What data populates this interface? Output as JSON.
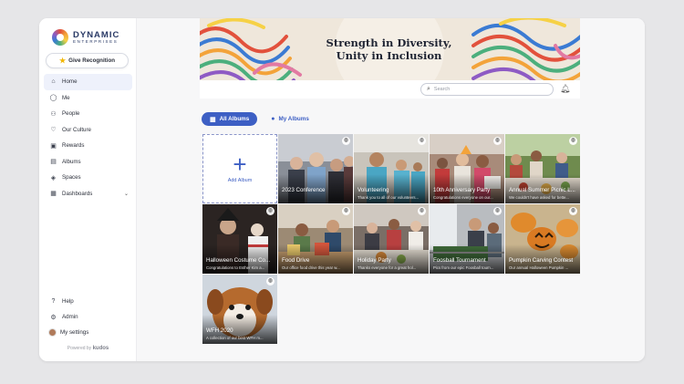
{
  "brand": {
    "name": "DYNAMIC",
    "sub": "ENTERPRISES"
  },
  "give_recognition": "Give Recognition",
  "nav": [
    {
      "label": "Home",
      "icon": "home-icon"
    },
    {
      "label": "Me",
      "icon": "user-icon"
    },
    {
      "label": "People",
      "icon": "people-icon"
    },
    {
      "label": "Our Culture",
      "icon": "heart-icon"
    },
    {
      "label": "Rewards",
      "icon": "gift-icon"
    },
    {
      "label": "Albums",
      "icon": "photo-icon"
    },
    {
      "label": "Spaces",
      "icon": "layers-icon"
    },
    {
      "label": "Dashboards",
      "icon": "dashboard-icon"
    }
  ],
  "bottom_nav": {
    "help": "Help",
    "admin": "Admin",
    "settings": "My settings"
  },
  "powered": {
    "prefix": "Powered by",
    "brand": "kudos"
  },
  "banner": {
    "line1": "Strength in Diversity,",
    "line2": "Unity in Inclusion"
  },
  "search": {
    "placeholder": "Search"
  },
  "tabs": {
    "all": "All Albums",
    "my": "My Albums"
  },
  "add_album": "Add Album",
  "albums": [
    {
      "title": "2023 Conference",
      "desc": ""
    },
    {
      "title": "Volunteering",
      "desc": "Thank you to all of our volunteers..."
    },
    {
      "title": "10th Anniversary Party",
      "desc": "Congratulations everyone on our..."
    },
    {
      "title": "Annual Summer Picnic L...",
      "desc": "We couldn't have asked for bette..."
    },
    {
      "title": "Halloween Costume Co...",
      "desc": "Congratulations to Esther Kim a..."
    },
    {
      "title": "Food Drive",
      "desc": "Our office food drive this year w..."
    },
    {
      "title": "Holiday Party",
      "desc": "Thanks everyone for a great hol..."
    },
    {
      "title": "Foosball Tournament",
      "desc": "Pics from our epic Foosball tourn..."
    },
    {
      "title": "Pumpkin Carving Contest",
      "desc": "Our annual Halloween Pumpkin ..."
    },
    {
      "title": "WFH 2020",
      "desc": "A collection of our best WFH m..."
    }
  ]
}
